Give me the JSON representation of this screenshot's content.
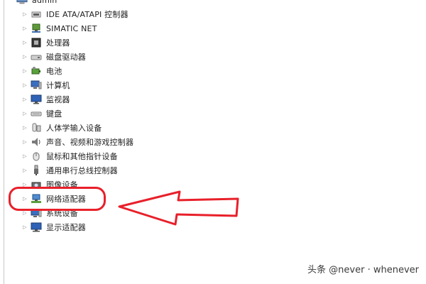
{
  "tree": {
    "root_label": "admin",
    "items": [
      {
        "label": "IDE ATA/ATAPI 控制器",
        "icon": "ide-controller-icon"
      },
      {
        "label": "SIMATIC NET",
        "icon": "network-node-icon"
      },
      {
        "label": "处理器",
        "icon": "processor-icon"
      },
      {
        "label": "磁盘驱动器",
        "icon": "disk-drive-icon"
      },
      {
        "label": "电池",
        "icon": "battery-icon"
      },
      {
        "label": "计算机",
        "icon": "computer-icon"
      },
      {
        "label": "监视器",
        "icon": "monitor-icon"
      },
      {
        "label": "键盘",
        "icon": "keyboard-icon"
      },
      {
        "label": "人体学输入设备",
        "icon": "hid-icon"
      },
      {
        "label": "声音、视频和游戏控制器",
        "icon": "speaker-icon"
      },
      {
        "label": "鼠标和其他指针设备",
        "icon": "mouse-icon"
      },
      {
        "label": "通用串行总线控制器",
        "icon": "usb-icon"
      },
      {
        "label": "图像设备",
        "icon": "camera-icon"
      },
      {
        "label": "网络适配器",
        "icon": "network-adapter-icon"
      },
      {
        "label": "系统设备",
        "icon": "system-device-icon"
      },
      {
        "label": "显示适配器",
        "icon": "display-adapter-icon"
      }
    ]
  },
  "annotation": {
    "oval_color": "#e8202a",
    "arrow_color": "#e8202a"
  },
  "watermark": {
    "text": "头条 @never · whenever"
  }
}
